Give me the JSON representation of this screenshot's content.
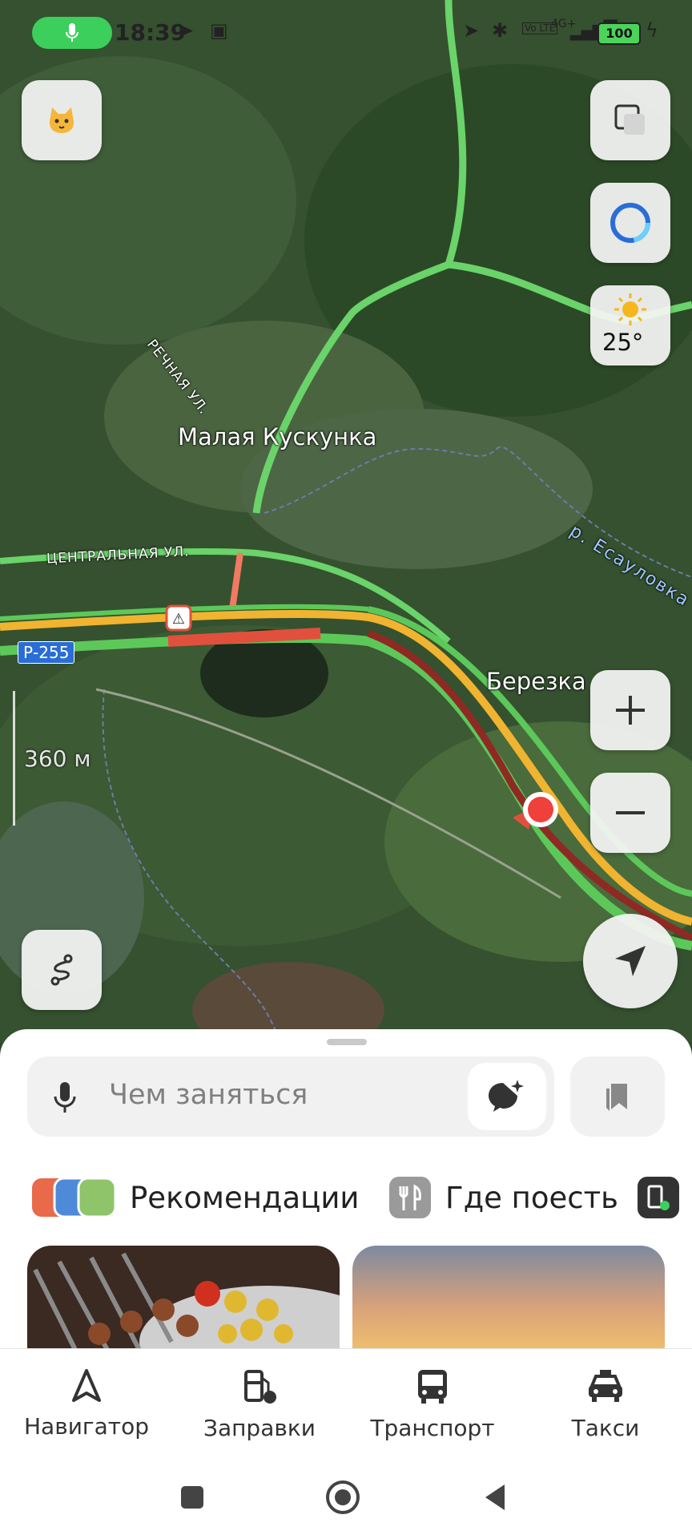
{
  "status_bar": {
    "time": "18:39",
    "battery": "100",
    "network": "4G+",
    "volte": "Vo LTE"
  },
  "map": {
    "places": {
      "malaya_kuskunka": "Малая Кускунка",
      "berezka": "Березка"
    },
    "streets": {
      "rechnaya": "РЕЧНАЯ УЛ.",
      "tsentralnaya": "ЦЕНТРАЛЬНАЯ УЛ."
    },
    "river": "р. Есауловка",
    "road_number": "Р-255",
    "scale": "360 м",
    "weather_temp": "25°"
  },
  "search": {
    "placeholder": "Чем заняться"
  },
  "categories": [
    {
      "label": "Рекомендации"
    },
    {
      "label": "Где поесть"
    }
  ],
  "tabs": [
    {
      "label": "Навигатор",
      "icon": "navigator-icon"
    },
    {
      "label": "Заправки",
      "icon": "fuel-icon"
    },
    {
      "label": "Транспорт",
      "icon": "bus-icon"
    },
    {
      "label": "Такси",
      "icon": "taxi-icon"
    }
  ],
  "colors": {
    "traffic_green": "#5cc85a",
    "traffic_yellow": "#f0b430",
    "traffic_red": "#e0503c",
    "traffic_darkred": "#8e2a23",
    "accent_blue": "#2a6dd6"
  }
}
